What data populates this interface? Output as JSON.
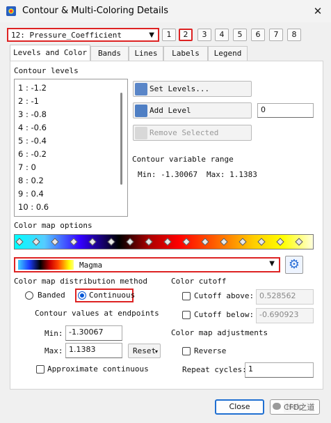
{
  "window": {
    "title": "Contour & Multi-Coloring Details"
  },
  "zone_selector": {
    "selected": "12: Pressure_Coefficient",
    "group_buttons": [
      "1",
      "2",
      "3",
      "4",
      "5",
      "6",
      "7",
      "8"
    ],
    "selected_group": "2"
  },
  "tabs": [
    "Levels and Color",
    "Bands",
    "Lines",
    "Labels",
    "Legend"
  ],
  "active_tab": "Levels and Color",
  "contour_levels": {
    "label": "Contour levels",
    "items": [
      "1 : -1.2",
      "2 : -1",
      "3 : -0.8",
      "4 : -0.6",
      "5 : -0.4",
      "6 : -0.2",
      "7 : 0",
      "8 : 0.2",
      "9 : 0.4",
      "10 : 0.6"
    ]
  },
  "level_actions": {
    "set_levels": "Set Levels...",
    "add_level": "Add Level",
    "add_level_value": "0",
    "remove_selected": "Remove Selected"
  },
  "variable_range": {
    "label": "Contour variable range",
    "min_text": "Min: -1.30067",
    "max_text": "Max: 1.1383"
  },
  "color_map": {
    "options_label": "Color map options",
    "selected": "Magma",
    "distribution_label": "Color map distribution method",
    "banded_label": "Banded",
    "continuous_label": "Continuous",
    "distribution": "Continuous",
    "endpoints_label": "Contour values at endpoints",
    "min_label": "Min:",
    "min_value": "-1.30067",
    "max_label": "Max:",
    "max_value": "1.1383",
    "reset_label": "Reset",
    "approx_label": "Approximate continuous",
    "approx_checked": false
  },
  "color_cutoff": {
    "label": "Color cutoff",
    "above_label": "Cutoff above:",
    "above_value": "0.528562",
    "above_checked": false,
    "below_label": "Cutoff below:",
    "below_value": "-0.690923",
    "below_checked": false
  },
  "color_map_adjustments": {
    "label": "Color map adjustments",
    "reverse_label": "Reverse",
    "reverse_checked": false,
    "repeat_label": "Repeat cycles:",
    "repeat_value": "1"
  },
  "footer": {
    "close_label": "Close",
    "help_label": "Help"
  },
  "watermark": "CFD之道",
  "colors": {
    "accent": "#1f6fd1",
    "highlight_frame": "#dd2222"
  }
}
